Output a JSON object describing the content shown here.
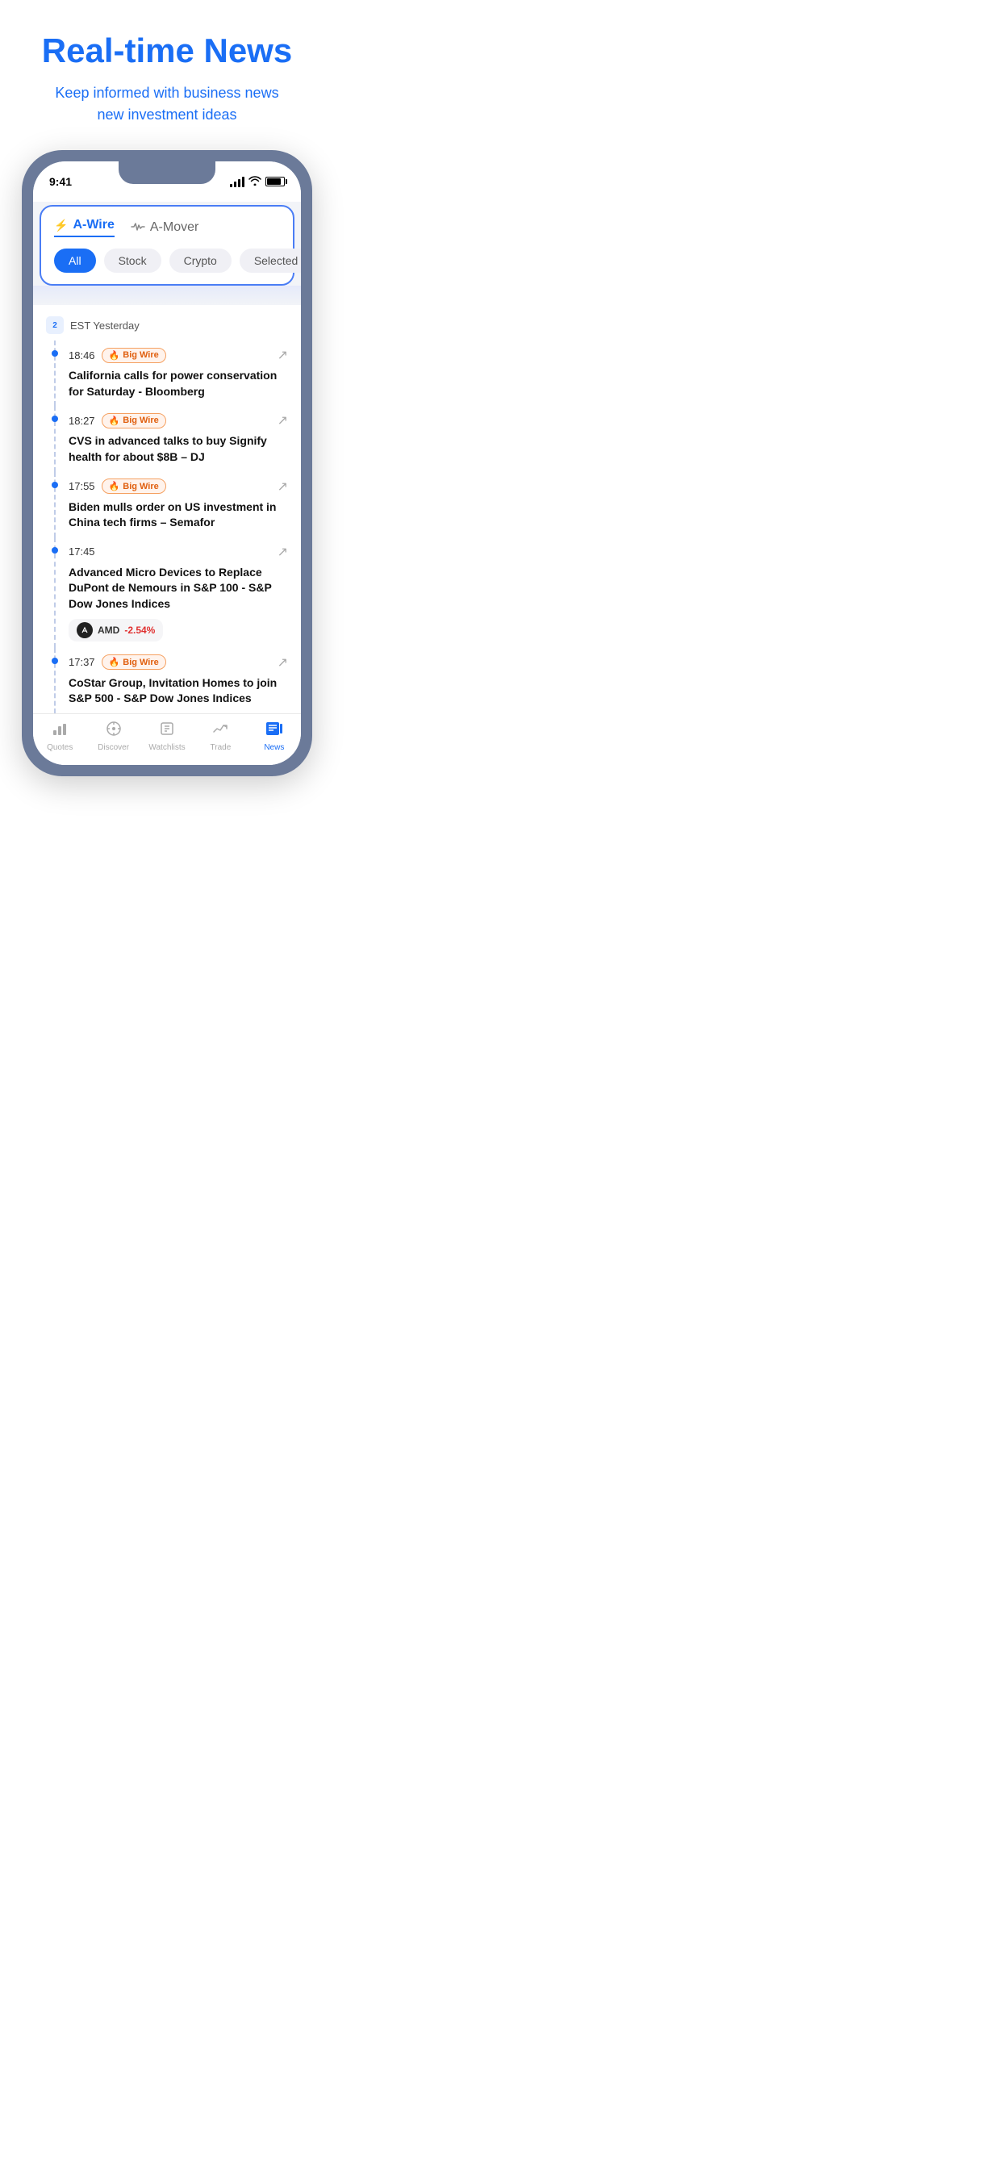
{
  "hero": {
    "title": "Real-time News",
    "subtitle_line1": "Keep informed with business news",
    "subtitle_line2": "new investment ideas"
  },
  "phone": {
    "status_time": "9:41",
    "tab_awire": "A-Wire",
    "tab_amover": "A-Mover",
    "filters": [
      "All",
      "Stock",
      "Crypto",
      "Selected"
    ],
    "active_filter": "All",
    "date_label": "EST Yesterday",
    "news_items": [
      {
        "time": "18:46",
        "badge": "Big Wire",
        "headline": "California calls for power conservation for Saturday - Bloomberg",
        "has_share": true
      },
      {
        "time": "18:27",
        "badge": "Big Wire",
        "headline": "CVS in advanced talks to buy Signify health for about $8B – DJ",
        "has_share": true
      },
      {
        "time": "17:55",
        "badge": "Big Wire",
        "headline": "Biden mulls order on US investment in China tech firms – Semafor",
        "has_share": true
      },
      {
        "time": "17:45",
        "badge": null,
        "headline": "Advanced Micro Devices to Replace DuPont de Nemours in S&P 100 - S&P Dow Jones Indices",
        "has_share": true,
        "stock": {
          "ticker": "AMD",
          "change": "-2.54%"
        }
      },
      {
        "time": "17:37",
        "badge": "Big Wire",
        "headline": "CoStar Group, Invitation Homes to join S&P 500 - S&P Dow Jones Indices",
        "has_share": true,
        "truncated": true
      }
    ]
  },
  "bottom_nav": {
    "items": [
      "Quotes",
      "Discover",
      "Watchlists",
      "Trade",
      "News"
    ],
    "active": "News",
    "icons": [
      "chart-icon",
      "discover-icon",
      "watchlist-icon",
      "trade-icon",
      "news-icon"
    ]
  }
}
